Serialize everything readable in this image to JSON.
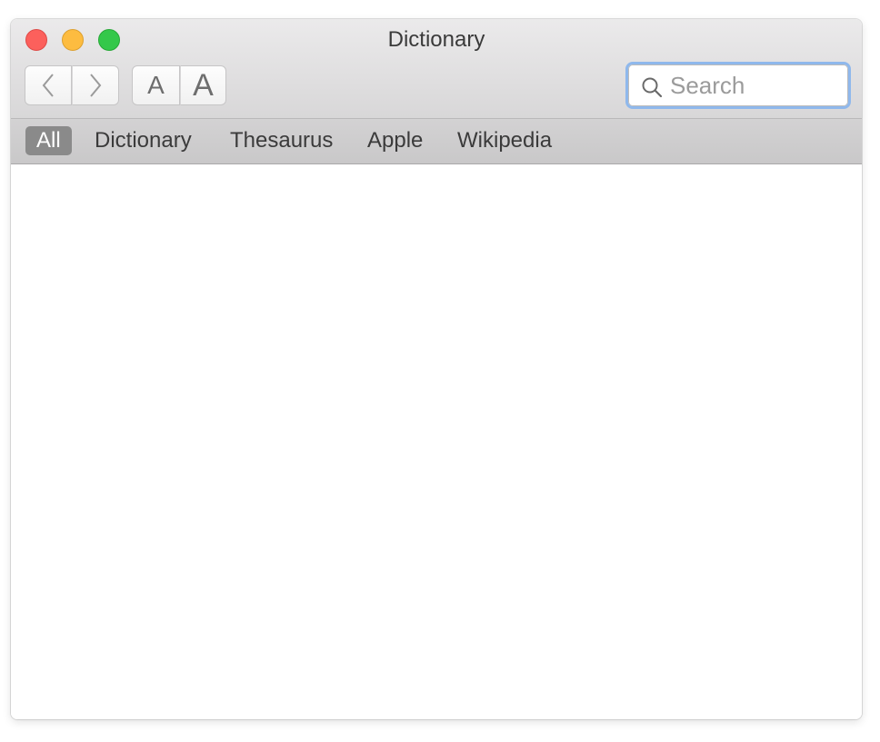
{
  "window": {
    "title": "Dictionary"
  },
  "toolbar": {
    "back_icon": "chevron-left-icon",
    "forward_icon": "chevron-right-icon",
    "font_smaller_label": "A",
    "font_larger_label": "A",
    "search": {
      "placeholder": "Search",
      "value": "",
      "icon": "magnifier-icon"
    }
  },
  "tabs": [
    {
      "label": "All",
      "active": true
    },
    {
      "label": "Dictionary",
      "active": false
    },
    {
      "label": "Thesaurus",
      "active": false
    },
    {
      "label": "Apple",
      "active": false
    },
    {
      "label": "Wikipedia",
      "active": false
    }
  ],
  "colors": {
    "close": "#fc605c",
    "minimize": "#fdbc40",
    "maximize": "#34c84a",
    "search_focus": "#8fb8ec",
    "active_tab": "#8a8a8a"
  }
}
